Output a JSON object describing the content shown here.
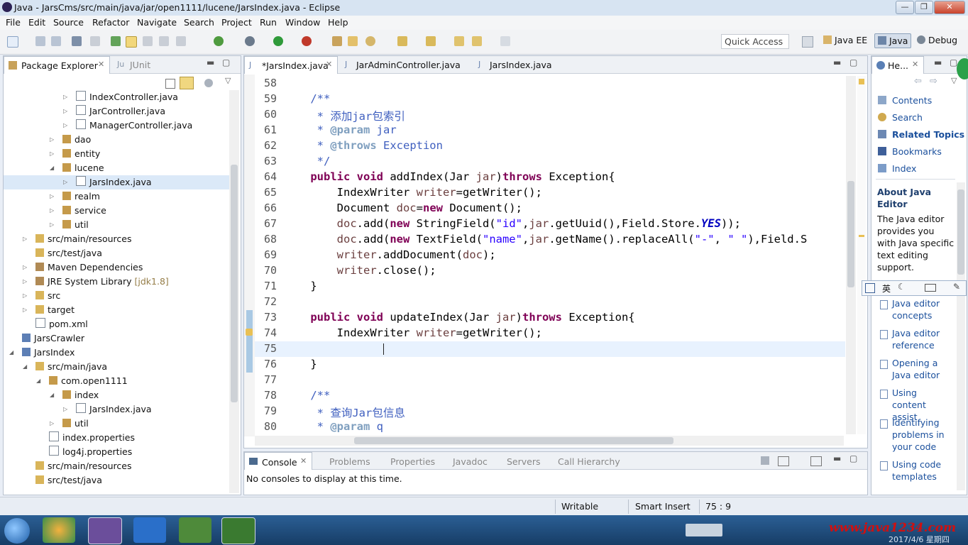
{
  "window": {
    "title": "Java - JarsCms/src/main/java/jar/open1111/lucene/JarsIndex.java - Eclipse",
    "minimize": "—",
    "maximize": "❐",
    "close": "✕"
  },
  "menu": [
    "File",
    "Edit",
    "Source",
    "Refactor",
    "Navigate",
    "Search",
    "Project",
    "Run",
    "Window",
    "Help"
  ],
  "toolbar": {
    "quick_access": "Quick Access",
    "perspectives": [
      "Java EE",
      "Java",
      "Debug"
    ]
  },
  "package_explorer": {
    "tabs": [
      "Package Explorer",
      "JUnit"
    ],
    "tree": [
      {
        "label": "IndexController.java",
        "type": "java-file",
        "level": 4,
        "expander": "collapsed"
      },
      {
        "label": "JarController.java",
        "type": "java-file",
        "level": 4,
        "expander": "collapsed"
      },
      {
        "label": "ManagerController.java",
        "type": "java-file",
        "level": 4,
        "expander": "collapsed"
      },
      {
        "label": "dao",
        "type": "package",
        "level": 3,
        "expander": "collapsed"
      },
      {
        "label": "entity",
        "type": "package",
        "level": 3,
        "expander": "collapsed"
      },
      {
        "label": "lucene",
        "type": "package",
        "level": 3,
        "expander": "expanded"
      },
      {
        "label": "JarsIndex.java",
        "type": "java-file",
        "level": 4,
        "expander": "collapsed",
        "selected": true
      },
      {
        "label": "realm",
        "type": "package",
        "level": 3,
        "expander": "collapsed"
      },
      {
        "label": "service",
        "type": "package",
        "level": 3,
        "expander": "collapsed"
      },
      {
        "label": "util",
        "type": "package",
        "level": 3,
        "expander": "collapsed"
      },
      {
        "label": "src/main/resources",
        "type": "folder",
        "level": 1,
        "expander": "collapsed"
      },
      {
        "label": "src/test/java",
        "type": "folder",
        "level": 1,
        "expander": "none"
      },
      {
        "label": "Maven Dependencies",
        "type": "library",
        "level": 1,
        "expander": "collapsed"
      },
      {
        "label": "JRE System Library",
        "suffix": "[jdk1.8]",
        "type": "library",
        "level": 1,
        "expander": "collapsed"
      },
      {
        "label": "src",
        "type": "folder",
        "level": 1,
        "expander": "collapsed"
      },
      {
        "label": "target",
        "type": "folder",
        "level": 1,
        "expander": "collapsed"
      },
      {
        "label": "pom.xml",
        "type": "xml-file",
        "level": 1,
        "expander": "none"
      },
      {
        "label": "JarsCrawler",
        "type": "project",
        "level": 0,
        "expander": "none"
      },
      {
        "label": "JarsIndex",
        "type": "project",
        "level": 0,
        "expander": "expanded"
      },
      {
        "label": "src/main/java",
        "type": "folder",
        "level": 1,
        "expander": "expanded"
      },
      {
        "label": "com.open1111",
        "type": "package",
        "level": 2,
        "expander": "expanded"
      },
      {
        "label": "index",
        "type": "package",
        "level": 3,
        "expander": "expanded"
      },
      {
        "label": "JarsIndex.java",
        "type": "java-file",
        "level": 4,
        "expander": "collapsed"
      },
      {
        "label": "util",
        "type": "package",
        "level": 3,
        "expander": "collapsed"
      },
      {
        "label": "index.properties",
        "type": "file",
        "level": 2,
        "expander": "none"
      },
      {
        "label": "log4j.properties",
        "type": "file",
        "level": 2,
        "expander": "none"
      },
      {
        "label": "src/main/resources",
        "type": "folder",
        "level": 1,
        "expander": "none"
      },
      {
        "label": "src/test/java",
        "type": "folder",
        "level": 1,
        "expander": "none"
      }
    ]
  },
  "editor": {
    "tabs": [
      {
        "label": "*JarsIndex.java",
        "active": true
      },
      {
        "label": "JarAdminController.java",
        "active": false
      },
      {
        "label": "JarsIndex.java",
        "active": false
      }
    ],
    "lines": [
      {
        "num": "58",
        "tokens": []
      },
      {
        "num": "59",
        "tokens": [
          {
            "t": "    /**",
            "c": "cm"
          }
        ]
      },
      {
        "num": "60",
        "tokens": [
          {
            "t": "     * 添加jar包索引",
            "c": "cm"
          }
        ]
      },
      {
        "num": "61",
        "tokens": [
          {
            "t": "     * ",
            "c": "cm"
          },
          {
            "t": "@param",
            "c": "tag"
          },
          {
            "t": " jar",
            "c": "cm"
          }
        ]
      },
      {
        "num": "62",
        "tokens": [
          {
            "t": "     * ",
            "c": "cm"
          },
          {
            "t": "@throws",
            "c": "tag"
          },
          {
            "t": " Exception",
            "c": "cm"
          }
        ]
      },
      {
        "num": "63",
        "tokens": [
          {
            "t": "     */",
            "c": "cm"
          }
        ]
      },
      {
        "num": "64",
        "tokens": [
          {
            "t": "    ",
            "c": "typ"
          },
          {
            "t": "public",
            "c": "kw"
          },
          {
            "t": " ",
            "c": "typ"
          },
          {
            "t": "void",
            "c": "kw"
          },
          {
            "t": " addIndex(Jar ",
            "c": "typ"
          },
          {
            "t": "jar",
            "c": "var"
          },
          {
            "t": ")",
            "c": "typ"
          },
          {
            "t": "throws",
            "c": "kw"
          },
          {
            "t": " Exception{",
            "c": "typ"
          }
        ]
      },
      {
        "num": "65",
        "tokens": [
          {
            "t": "        IndexWriter ",
            "c": "typ"
          },
          {
            "t": "writer",
            "c": "var"
          },
          {
            "t": "=getWriter();",
            "c": "typ"
          }
        ]
      },
      {
        "num": "66",
        "tokens": [
          {
            "t": "        Document ",
            "c": "typ"
          },
          {
            "t": "doc",
            "c": "var"
          },
          {
            "t": "=",
            "c": "typ"
          },
          {
            "t": "new",
            "c": "kw"
          },
          {
            "t": " Document();",
            "c": "typ"
          }
        ]
      },
      {
        "num": "67",
        "tokens": [
          {
            "t": "        ",
            "c": "typ"
          },
          {
            "t": "doc",
            "c": "var"
          },
          {
            "t": ".add(",
            "c": "typ"
          },
          {
            "t": "new",
            "c": "kw"
          },
          {
            "t": " StringField(",
            "c": "typ"
          },
          {
            "t": "\"id\"",
            "c": "str"
          },
          {
            "t": ",",
            "c": "typ"
          },
          {
            "t": "jar",
            "c": "var"
          },
          {
            "t": ".getUuid(),Field.Store.",
            "c": "typ"
          },
          {
            "t": "YES",
            "c": "fld"
          },
          {
            "t": "));",
            "c": "typ"
          }
        ]
      },
      {
        "num": "68",
        "tokens": [
          {
            "t": "        ",
            "c": "typ"
          },
          {
            "t": "doc",
            "c": "var"
          },
          {
            "t": ".add(",
            "c": "typ"
          },
          {
            "t": "new",
            "c": "kw"
          },
          {
            "t": " TextField(",
            "c": "typ"
          },
          {
            "t": "\"name\"",
            "c": "str"
          },
          {
            "t": ",",
            "c": "typ"
          },
          {
            "t": "jar",
            "c": "var"
          },
          {
            "t": ".getName().replaceAll(",
            "c": "typ"
          },
          {
            "t": "\"-\"",
            "c": "str"
          },
          {
            "t": ", ",
            "c": "typ"
          },
          {
            "t": "\" \"",
            "c": "str"
          },
          {
            "t": "),Field.S",
            "c": "typ"
          }
        ]
      },
      {
        "num": "69",
        "tokens": [
          {
            "t": "        ",
            "c": "typ"
          },
          {
            "t": "writer",
            "c": "var"
          },
          {
            "t": ".addDocument(",
            "c": "typ"
          },
          {
            "t": "doc",
            "c": "var"
          },
          {
            "t": ");",
            "c": "typ"
          }
        ]
      },
      {
        "num": "70",
        "tokens": [
          {
            "t": "        ",
            "c": "typ"
          },
          {
            "t": "writer",
            "c": "var"
          },
          {
            "t": ".close();",
            "c": "typ"
          }
        ]
      },
      {
        "num": "71",
        "tokens": [
          {
            "t": "    }",
            "c": "typ"
          }
        ]
      },
      {
        "num": "72",
        "tokens": []
      },
      {
        "num": "73",
        "tokens": [
          {
            "t": "    ",
            "c": "typ"
          },
          {
            "t": "public",
            "c": "kw"
          },
          {
            "t": " ",
            "c": "typ"
          },
          {
            "t": "void",
            "c": "kw"
          },
          {
            "t": " updateIndex(Jar ",
            "c": "typ"
          },
          {
            "t": "jar",
            "c": "var"
          },
          {
            "t": ")",
            "c": "typ"
          },
          {
            "t": "throws",
            "c": "kw"
          },
          {
            "t": " Exception{",
            "c": "typ"
          }
        ]
      },
      {
        "num": "74",
        "tokens": [
          {
            "t": "        IndexWriter ",
            "c": "typ"
          },
          {
            "t": "writer",
            "c": "var"
          },
          {
            "t": "=getWriter();",
            "c": "typ"
          }
        ]
      },
      {
        "num": "75",
        "tokens": [],
        "current": true
      },
      {
        "num": "76",
        "tokens": [
          {
            "t": "    }",
            "c": "typ"
          }
        ]
      },
      {
        "num": "77",
        "tokens": []
      },
      {
        "num": "78",
        "tokens": [
          {
            "t": "    /**",
            "c": "cm"
          }
        ]
      },
      {
        "num": "79",
        "tokens": [
          {
            "t": "     * 查询Jar包信息",
            "c": "cm"
          }
        ]
      },
      {
        "num": "80",
        "tokens": [
          {
            "t": "     * ",
            "c": "cm"
          },
          {
            "t": "@param",
            "c": "tag"
          },
          {
            "t": " q",
            "c": "cm"
          }
        ]
      }
    ]
  },
  "console": {
    "tabs": [
      "Console",
      "Problems",
      "Properties",
      "Javadoc",
      "Servers",
      "Call Hierarchy"
    ],
    "message": "No consoles to display at this time."
  },
  "help": {
    "tab": "He...",
    "links": [
      "Contents",
      "Search",
      "Related Topics",
      "Bookmarks",
      "Index"
    ],
    "about_title": "About Java Editor",
    "about_text": "The Java editor provides you with Java specific text editing support.",
    "ime_label": "英",
    "related": [
      "Java editor concepts",
      "Java editor reference",
      "Opening a Java editor",
      "Using content assist",
      "Identifying problems in your code",
      "Using code templates"
    ]
  },
  "status": {
    "writable": "Writable",
    "insert_mode": "Smart Insert",
    "position": "75 : 9"
  },
  "taskbar": {
    "date": "2017/4/6 星期四",
    "watermark": "www.java1234.com"
  }
}
